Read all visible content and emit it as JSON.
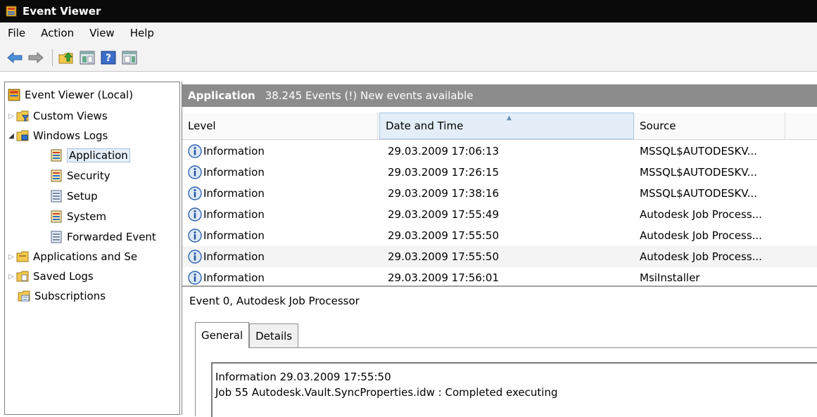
{
  "window": {
    "title": "Event Viewer"
  },
  "menu": [
    "File",
    "Action",
    "View",
    "Help"
  ],
  "toolbar": {
    "icons": [
      "back-arrow-icon",
      "forward-arrow-icon",
      "folder-up-icon",
      "show-hide-tree-icon",
      "help-icon",
      "show-hide-action-pane-icon"
    ]
  },
  "tree": {
    "root": "Event Viewer (Local)",
    "items": [
      {
        "label": "Custom Views",
        "level": 1,
        "expander": "collapsed"
      },
      {
        "label": "Windows Logs",
        "level": 1,
        "expander": "expanded"
      },
      {
        "label": "Application",
        "level": 2,
        "selected": true
      },
      {
        "label": "Security",
        "level": 2
      },
      {
        "label": "Setup",
        "level": 2
      },
      {
        "label": "System",
        "level": 2
      },
      {
        "label": "Forwarded Event",
        "level": 2
      },
      {
        "label": "Applications and Se",
        "level": 1,
        "expander": "collapsed"
      },
      {
        "label": "Saved Logs",
        "level": 1,
        "expander": "collapsed"
      },
      {
        "label": "Subscriptions",
        "level": 1
      }
    ]
  },
  "log": {
    "name": "Application",
    "summary": "38.245 Events (!) New events available"
  },
  "grid": {
    "columns": [
      "Level",
      "Date and Time",
      "Source"
    ],
    "rows": [
      {
        "level": "Information",
        "datetime": "29.03.2009 17:06:13",
        "source": "MSSQL$AUTODESKV..."
      },
      {
        "level": "Information",
        "datetime": "29.03.2009 17:26:15",
        "source": "MSSQL$AUTODESKV..."
      },
      {
        "level": "Information",
        "datetime": "29.03.2009 17:38:16",
        "source": "MSSQL$AUTODESKV..."
      },
      {
        "level": "Information",
        "datetime": "29.03.2009 17:55:49",
        "source": "Autodesk Job Process..."
      },
      {
        "level": "Information",
        "datetime": "29.03.2009 17:55:50",
        "source": "Autodesk Job Process..."
      },
      {
        "level": "Information",
        "datetime": "29.03.2009 17:55:50",
        "source": "Autodesk Job Process..."
      },
      {
        "level": "Information",
        "datetime": "29.03.2009 17:56:01",
        "source": "MsiInstaller"
      }
    ]
  },
  "detail": {
    "title": "Event 0, Autodesk Job Processor",
    "tabs": [
      "General",
      "Details"
    ],
    "line1": "Information 29.03.2009 17:55:50",
    "line2": "Job 55 Autodesk.Vault.SyncProperties.idw : Completed executing"
  }
}
